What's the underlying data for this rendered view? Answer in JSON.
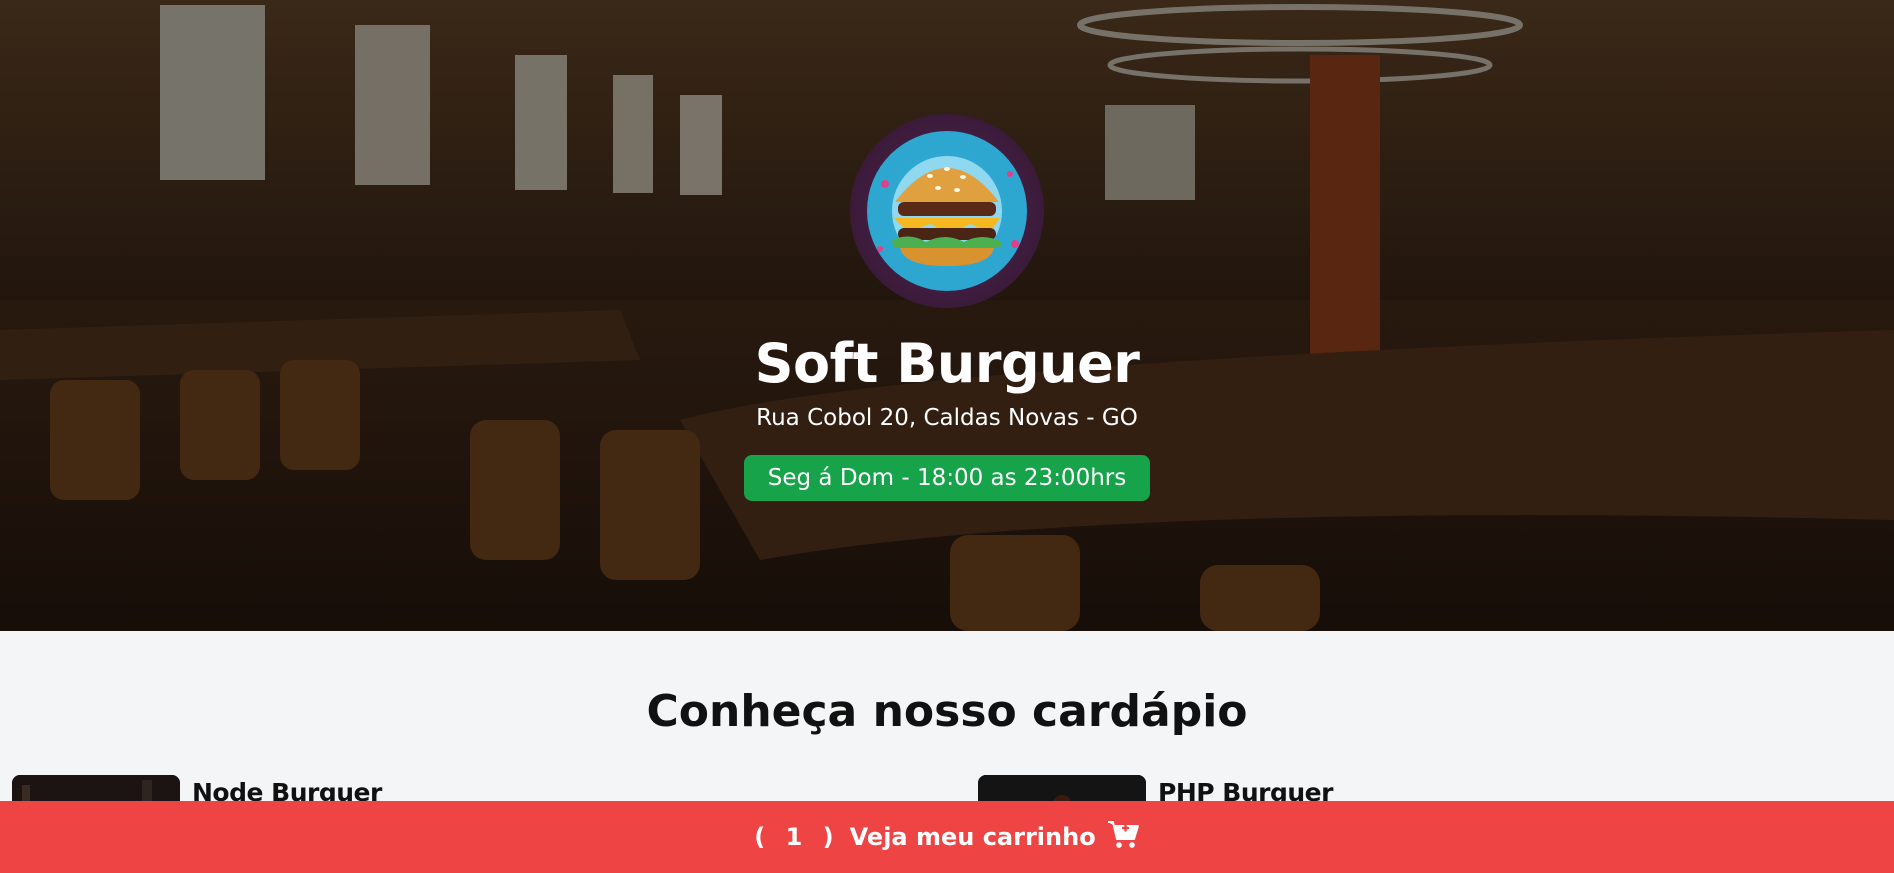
{
  "hero": {
    "shop_name": "Soft Burguer",
    "address": "Rua Cobol 20, Caldas Novas - GO",
    "hours": "Seg á Dom - 18:00 as 23:00hrs",
    "hours_color": "#16a34a"
  },
  "menu": {
    "title": "Conheça nosso cardápio",
    "products": [
      {
        "name": "Node Burguer"
      },
      {
        "name": "PHP Burguer"
      }
    ]
  },
  "cart": {
    "count_text": "( 1 )",
    "label": "Veja meu carrinho",
    "icon": "cart-plus-icon",
    "color": "#ef4444"
  }
}
